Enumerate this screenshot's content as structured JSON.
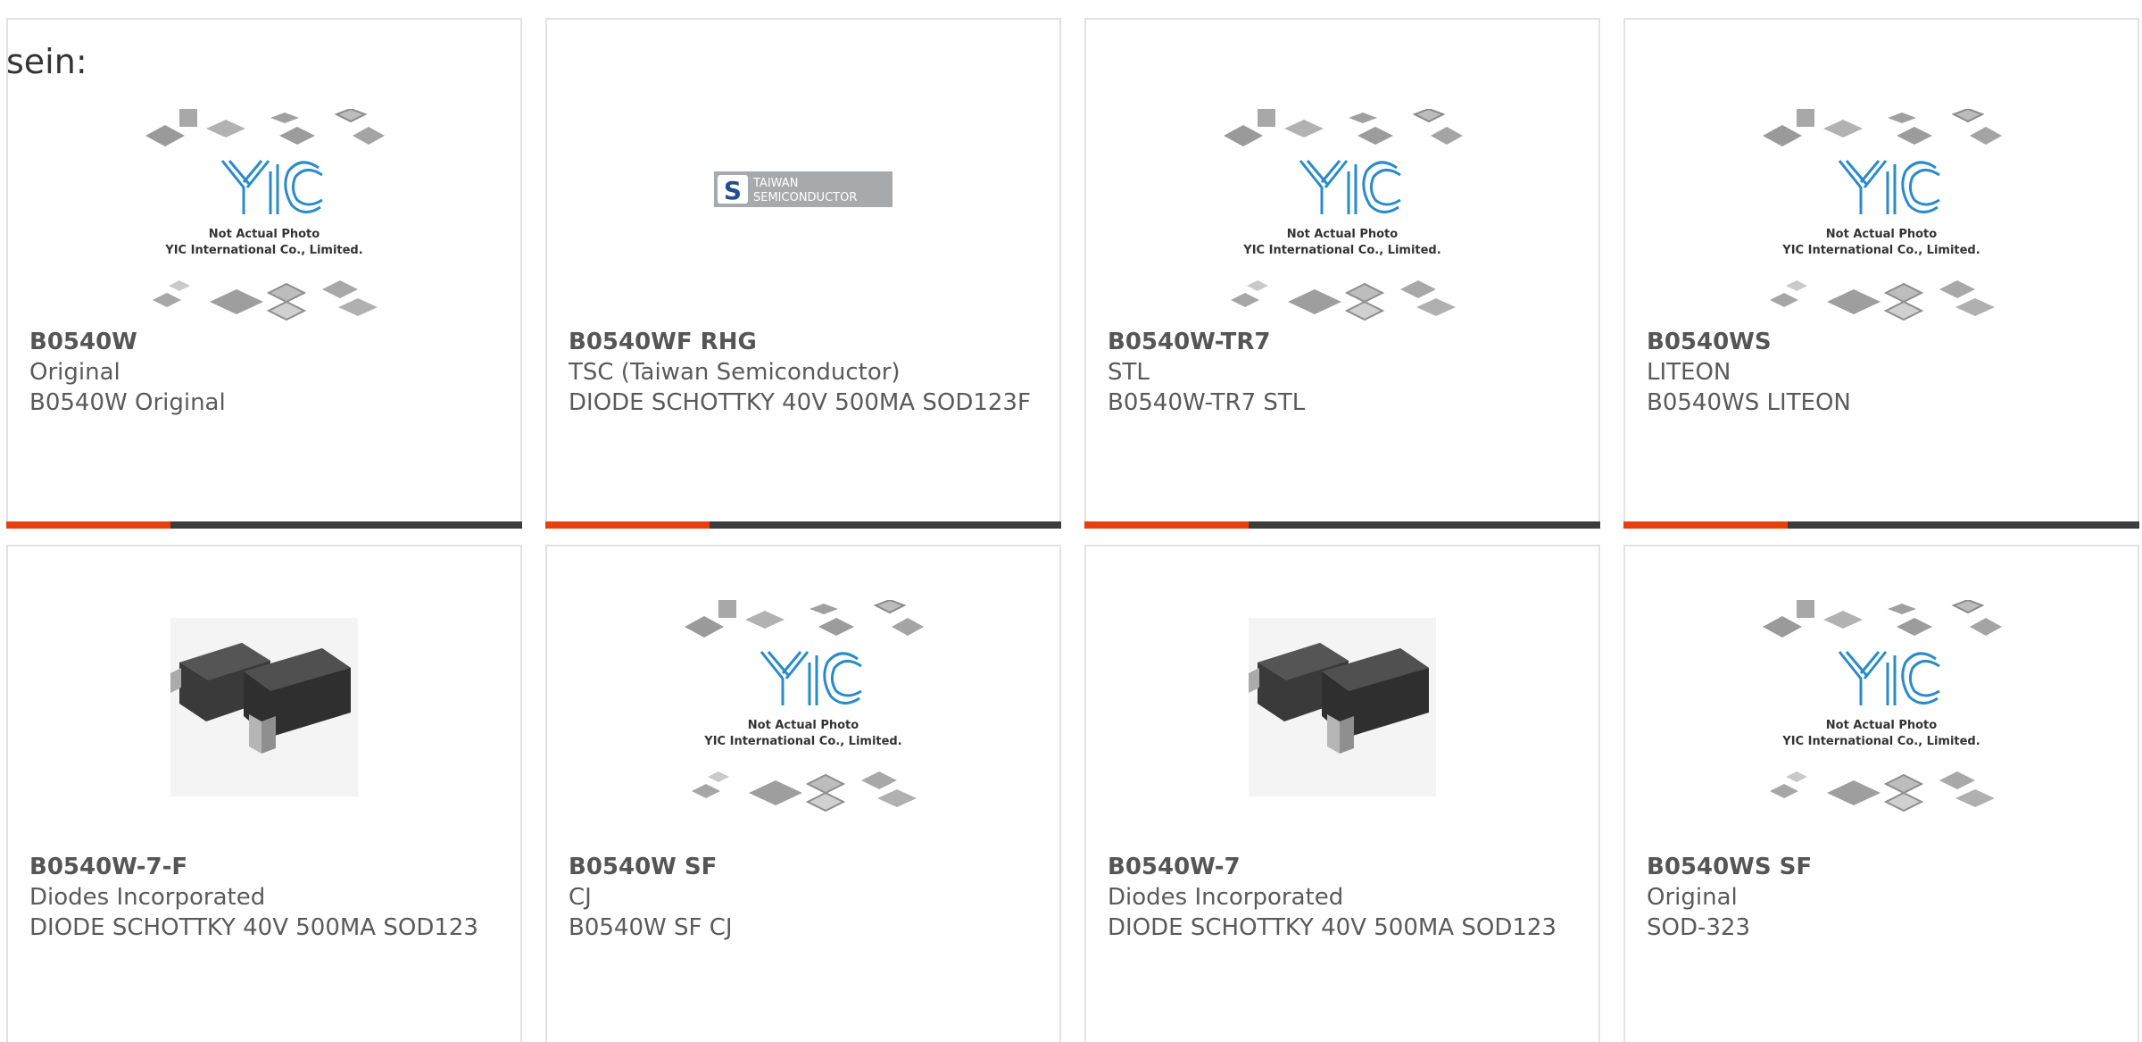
{
  "intro_text": "sein:",
  "placeholder": {
    "brand": "YIC",
    "line1": "Not Actual Photo",
    "line2": "YIC International Co., Limited."
  },
  "tsc_logo": {
    "mark": "S",
    "line1": "TAIWAN",
    "line2": "SEMICONDUCTOR"
  },
  "colors": {
    "accent": "#e8400c",
    "bar": "#3c3c3c",
    "border": "#e2e2e2",
    "text": "#5a5a5a",
    "yic_blue": "#2a8bc9"
  },
  "products": [
    {
      "part": "B0540W",
      "maker": "Original",
      "desc": "B0540W Original",
      "image": "yic-placeholder"
    },
    {
      "part": "B0540WF RHG",
      "maker": "TSC (Taiwan Semiconductor)",
      "desc": "DIODE SCHOTTKY 40V 500MA SOD123F",
      "image": "tsc-logo"
    },
    {
      "part": "B0540W-TR7",
      "maker": "STL",
      "desc": "B0540W-TR7 STL",
      "image": "yic-placeholder"
    },
    {
      "part": "B0540WS",
      "maker": "LITEON",
      "desc": "B0540WS LITEON",
      "image": "yic-placeholder"
    },
    {
      "part": "B0540W-7-F",
      "maker": "Diodes Incorporated",
      "desc": "DIODE SCHOTTKY 40V 500MA SOD123",
      "image": "sod123-photo"
    },
    {
      "part": "B0540W SF",
      "maker": "CJ",
      "desc": "B0540W SF CJ",
      "image": "yic-placeholder"
    },
    {
      "part": "B0540W-7",
      "maker": "Diodes Incorporated",
      "desc": "DIODE SCHOTTKY 40V 500MA SOD123",
      "image": "sod123-photo"
    },
    {
      "part": "B0540WS SF",
      "maker": "Original",
      "desc": "SOD-323",
      "image": "yic-placeholder"
    }
  ]
}
